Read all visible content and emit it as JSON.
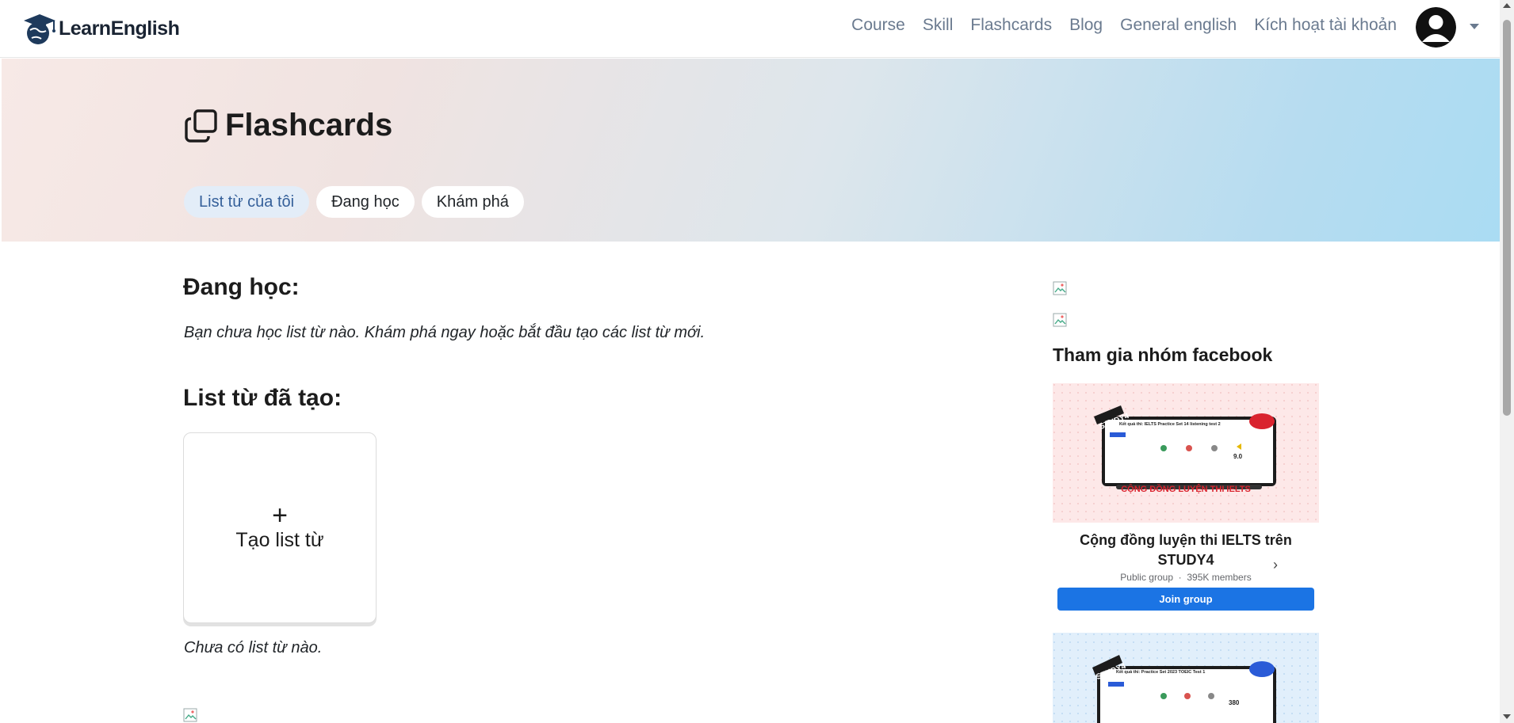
{
  "brand": {
    "name": "LearnEnglish"
  },
  "nav": {
    "links": [
      "Course",
      "Skill",
      "Flashcards",
      "Blog",
      "General english",
      "Kích hoạt tài khoản"
    ]
  },
  "hero": {
    "title": "Flashcards",
    "tabs": [
      {
        "label": "List từ của tôi",
        "active": true
      },
      {
        "label": "Đang học",
        "active": false
      },
      {
        "label": "Khám phá",
        "active": false
      }
    ]
  },
  "main": {
    "learning": {
      "title": "Đang học:",
      "empty_text": "Bạn chưa học list từ nào. Khám phá ngay hoặc bắt đầu tạo các list từ mới."
    },
    "created": {
      "title": "List từ đã tạo:",
      "create_plus": "+",
      "create_label": "Tạo list từ",
      "empty_text": "Chưa có list từ nào."
    }
  },
  "sidebar": {
    "title": "Tham gia nhóm facebook",
    "groups": [
      {
        "banner_brand": "STUDY4",
        "banner_caption": "CỘNG ĐỒNG LUYỆN THI IELTS",
        "banner_screen_title": "Kết quả thi: IELTS Practice Set 14 listening test 2",
        "banner_score": "9.0",
        "name": "Cộng đồng luyện thi IELTS trên STUDY4",
        "type": "Public group",
        "members": "395K members",
        "join_label": "Join group",
        "theme": "#fde8e8"
      },
      {
        "banner_brand": "STUDY4",
        "banner_screen_title": "Kết quả thi: Practice Set 2023 TOEIC Test 1",
        "banner_score": "380",
        "theme": "#e1effb"
      }
    ]
  },
  "colors": {
    "accent": "#1b74e4",
    "nav_text": "#6a7a8f",
    "tab_active_bg": "#e3edf8",
    "tab_active_text": "#35609a"
  }
}
